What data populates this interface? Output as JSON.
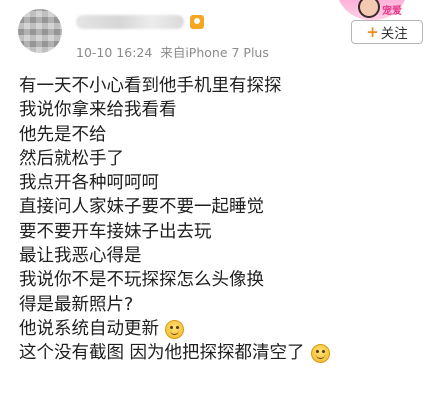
{
  "post": {
    "timestamp": "10-10 16:24",
    "source": "来自iPhone 7 Plus",
    "follow_label": "关注",
    "sticker_text": "宠爱",
    "lines": [
      "有一天不小心看到他手机里有探探",
      "我说你拿来给我看看",
      "他先是不给",
      "然后就松手了",
      "我点开各种呵呵呵",
      "直接问人家妹子要不要一起睡觉",
      "要不要开车接妹子出去玩",
      "最让我恶心得是",
      "我说你不是不玩探探怎么头像换",
      "得是最新照片?",
      "他说系统自动更新",
      "这个没有截图 因为他把探探都清空了"
    ]
  },
  "icons": {
    "follow_plus": "plus-icon",
    "emoji": "smile-emoji-icon",
    "badge": "level-badge-icon"
  },
  "colors": {
    "accent": "#f08c1a",
    "meta_text": "#8a8a8a",
    "body_text": "#1f1f1f"
  }
}
